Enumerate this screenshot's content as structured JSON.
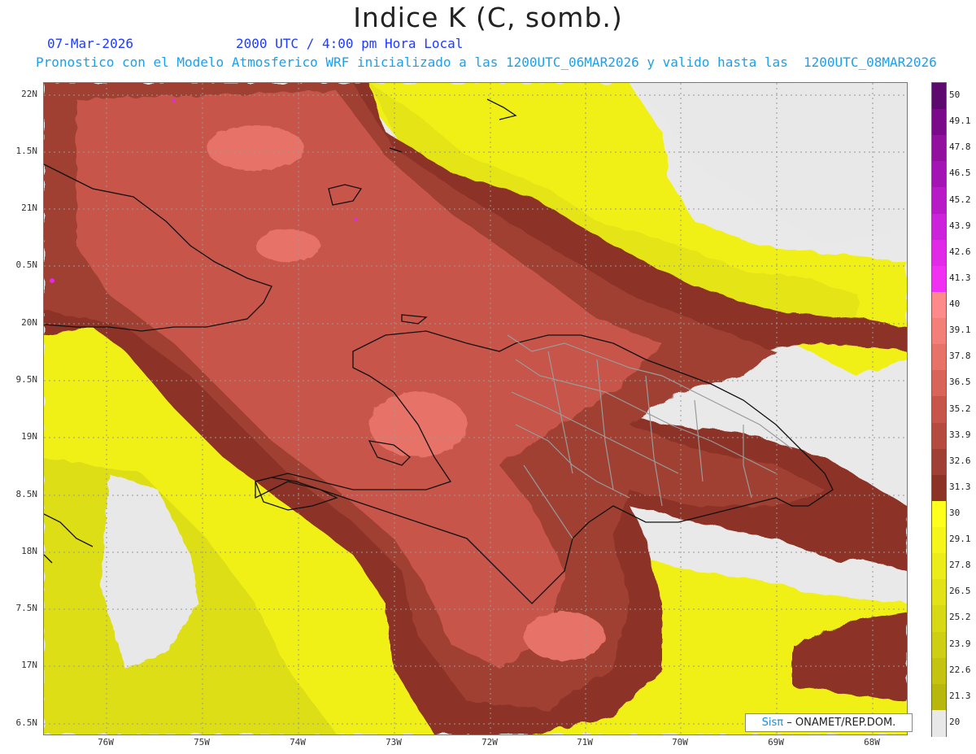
{
  "title": "Indice K (C, somb.)",
  "date_label": "07-Mar-2026",
  "time_label": "2000 UTC / 4:00 pm Hora Local",
  "forecast_text": "Pronostico con el Modelo Atmosferico WRF inicializado a las 1200UTC_06MAR2026 y valido hasta las  1200UTC_08MAR2026",
  "lat_labels": [
    "22N",
    "1.5N",
    "21N",
    "0.5N",
    "20N",
    "9.5N",
    "19N",
    "8.5N",
    "18N",
    "7.5N",
    "17N",
    "6.5N"
  ],
  "lon_labels": [
    "76W",
    "75W",
    "74W",
    "73W",
    "72W",
    "71W",
    "70W",
    "69W",
    "68W"
  ],
  "colorbar": {
    "labels": [
      "50",
      "49.1",
      "47.8",
      "46.5",
      "45.2",
      "43.9",
      "42.6",
      "41.3",
      "40",
      "39.1",
      "37.8",
      "36.5",
      "35.2",
      "33.9",
      "32.6",
      "31.3",
      "30",
      "29.1",
      "27.8",
      "26.5",
      "25.2",
      "23.9",
      "22.6",
      "21.3",
      "20"
    ],
    "colors": [
      "#5c0a6e",
      "#7a0a8a",
      "#92109e",
      "#a414b4",
      "#b81ac8",
      "#cc22dc",
      "#e02ae8",
      "#f030f2",
      "#ff8a8a",
      "#f38078",
      "#e67268",
      "#d9655a",
      "#c8554a",
      "#b54a3e",
      "#a03f33",
      "#8c3326",
      "#ffff1c",
      "#f5f51a",
      "#ecec18",
      "#e2e216",
      "#d8d814",
      "#cece12",
      "#c4c410",
      "#b8b80c",
      "#e8e8e8"
    ]
  },
  "credit": {
    "brand": "Sisπ",
    "text": "– ONAMET/REP.DOM."
  }
}
